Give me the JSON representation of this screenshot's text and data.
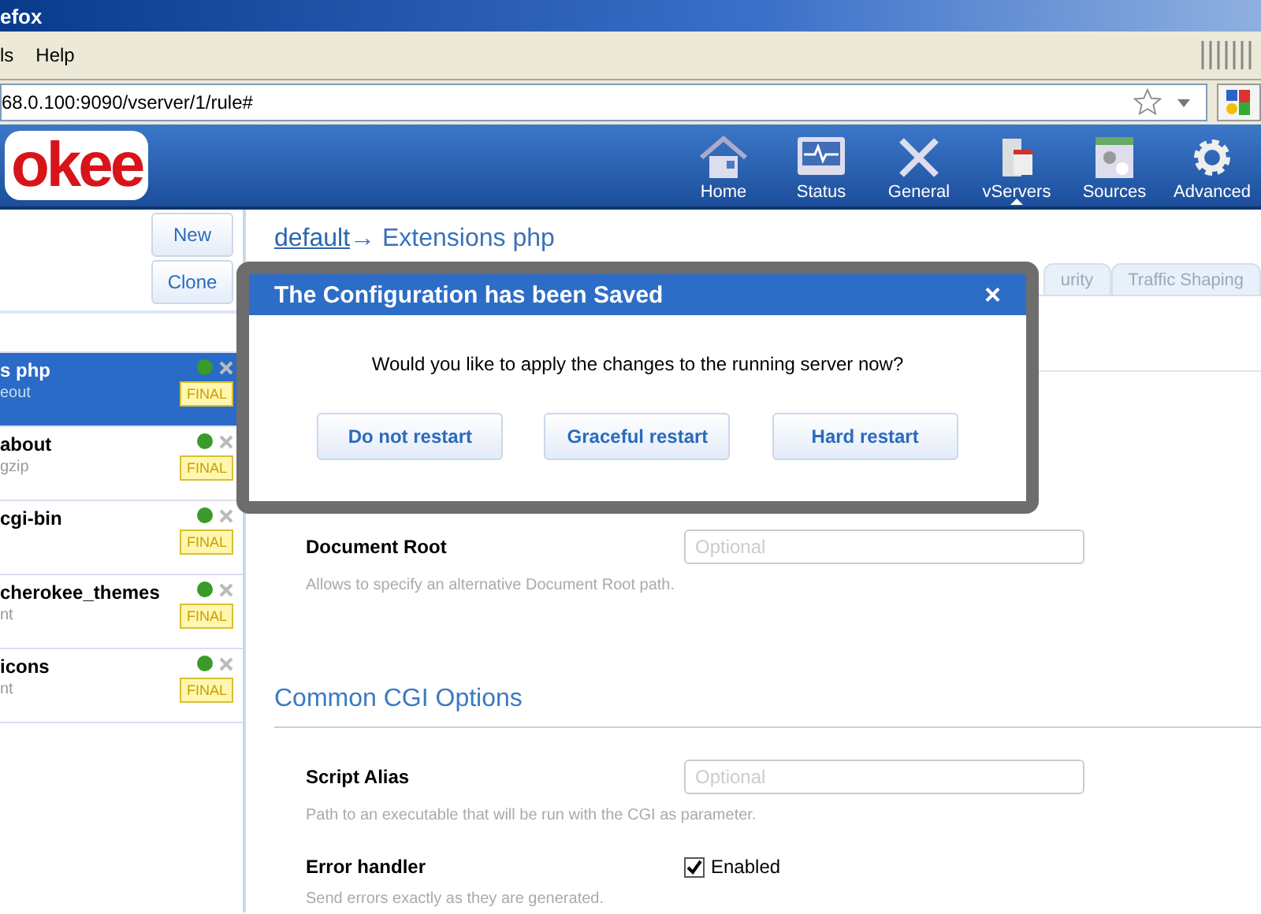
{
  "window": {
    "title": "efox"
  },
  "menu": [
    "ls",
    "Help"
  ],
  "address_bar": {
    "url": "68.0.100:9090/vserver/1/rule#"
  },
  "header": {
    "logo": "okee",
    "nav": [
      {
        "label": "Home",
        "selected": false
      },
      {
        "label": "Status",
        "selected": false
      },
      {
        "label": "General",
        "selected": false
      },
      {
        "label": "vServers",
        "selected": true
      },
      {
        "label": "Sources",
        "selected": false
      },
      {
        "label": "Advanced",
        "selected": false
      }
    ]
  },
  "sidebar": {
    "buttons": [
      "New",
      "Clone"
    ],
    "rules": [
      {
        "name": "s php",
        "detail": "eout",
        "active": true,
        "badge": "FINAL",
        "selected": true
      },
      {
        "name": "about",
        "detail": "gzip",
        "active": true,
        "badge": "FINAL",
        "selected": false
      },
      {
        "name": "cgi-bin",
        "active": true,
        "badge": "FINAL",
        "selected": false
      },
      {
        "name": "cherokee_themes",
        "detail": "nt",
        "active": true,
        "badge": "FINAL",
        "selected": false
      },
      {
        "name": "icons",
        "detail": "nt",
        "active": true,
        "badge": "FINAL",
        "selected": false
      }
    ]
  },
  "breadcrumb": {
    "link": "default",
    "rest": "→ Extensions php"
  },
  "tabs": [
    {
      "label": "urity",
      "selected": false
    },
    {
      "label": "Traffic Shaping",
      "selected": false
    }
  ],
  "sections": [
    {
      "fields": [
        {
          "label": "Document Root",
          "kind": "text",
          "placeholder": "Optional",
          "hint": "Allows to specify an alternative Document Root path."
        }
      ]
    },
    {
      "title": "Common CGI Options",
      "fields": [
        {
          "label": "Script Alias",
          "kind": "text",
          "placeholder": "Optional",
          "hint": "Path to an executable that will be run with the CGI as parameter."
        },
        {
          "label": "Error handler",
          "kind": "checkbox",
          "checked": true,
          "option": "Enabled",
          "hint": "Send errors exactly as they are generated."
        }
      ]
    }
  ],
  "dialog": {
    "title": "The Configuration has been Saved",
    "close": "×",
    "message": "Would you like to apply the changes to the running server now?",
    "buttons": [
      "Do not restart",
      "Graceful restart",
      "Hard restart"
    ]
  }
}
